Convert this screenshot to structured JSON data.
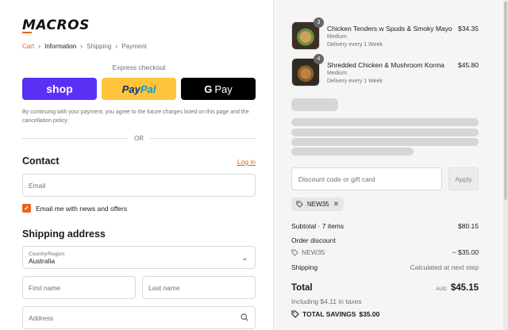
{
  "brand": {
    "logo": "MACROS"
  },
  "breadcrumb": [
    "Cart",
    "Information",
    "Shipping",
    "Payment"
  ],
  "express": {
    "label": "Express checkout",
    "shop": "shop",
    "paypal_pay": "Pay",
    "paypal_pal": "Pal",
    "gpay": "Pay",
    "gpay_g": "G"
  },
  "consent": "By continuing with your payment, you agree to the future charges listed on this page and the cancellation policy.",
  "divider": "OR",
  "contact": {
    "title": "Contact",
    "login": "Log in",
    "email_placeholder": "Email",
    "newsletter": "Email me with news and offers"
  },
  "shipping": {
    "title": "Shipping address",
    "country_label": "Country/Region",
    "country_value": "Australia",
    "first_name": "First name",
    "last_name": "Last name",
    "address": "Address"
  },
  "order": {
    "items": [
      {
        "name": "Chicken Tenders w Spuds & Smoky Mayo",
        "size": "Medium",
        "delivery": "Delivery every 1 Week",
        "price": "$34.35",
        "qty": "3"
      },
      {
        "name": "Shredded Chicken & Mushroom Korma",
        "size": "Medium",
        "delivery": "Delivery every 1 Week",
        "price": "$45.80",
        "qty": "4"
      }
    ],
    "discount_placeholder": "Discount code or gift card",
    "apply": "Apply",
    "code": "NEW35",
    "subtotal_label": "Subtotal · 7 items",
    "subtotal": "$80.15",
    "order_discount_label": "Order discount",
    "order_discount_code": "NEW35",
    "order_discount": "− $35.00",
    "shipping_label": "Shipping",
    "shipping_value": "Calculated at next step",
    "total_label": "Total",
    "currency": "AUD",
    "total": "$45.15",
    "taxes": "Including $4.11 in taxes",
    "savings_label": "TOTAL SAVINGS",
    "savings": "$35.00"
  },
  "colors": {
    "accent": "#e8641a",
    "shop": "#5a31f4",
    "paypal": "#ffc439"
  }
}
